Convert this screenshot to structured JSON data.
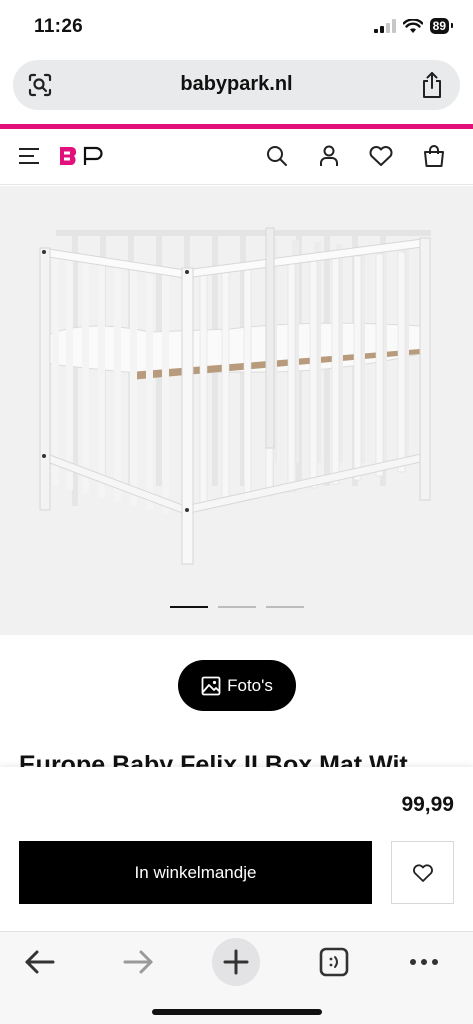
{
  "status": {
    "time": "11:26",
    "battery": "89"
  },
  "browser": {
    "url": "babypark.nl"
  },
  "site": {
    "logo_text": "BP",
    "brand_color": "#e2107b"
  },
  "gallery": {
    "slides": 3,
    "active_slide": 1,
    "fotos_label": "Foto's"
  },
  "product": {
    "title": "Europe Baby Felix II Box Mat Wit",
    "price": "99,99"
  },
  "buy": {
    "cart_label": "In winkelmandje"
  },
  "icons": {
    "header": [
      "menu-icon",
      "search-icon",
      "account-icon",
      "wishlist-icon",
      "bag-icon"
    ],
    "toolbar": [
      "back-icon",
      "forward-icon",
      "new-tab-icon",
      "tabs-icon",
      "more-icon"
    ]
  }
}
